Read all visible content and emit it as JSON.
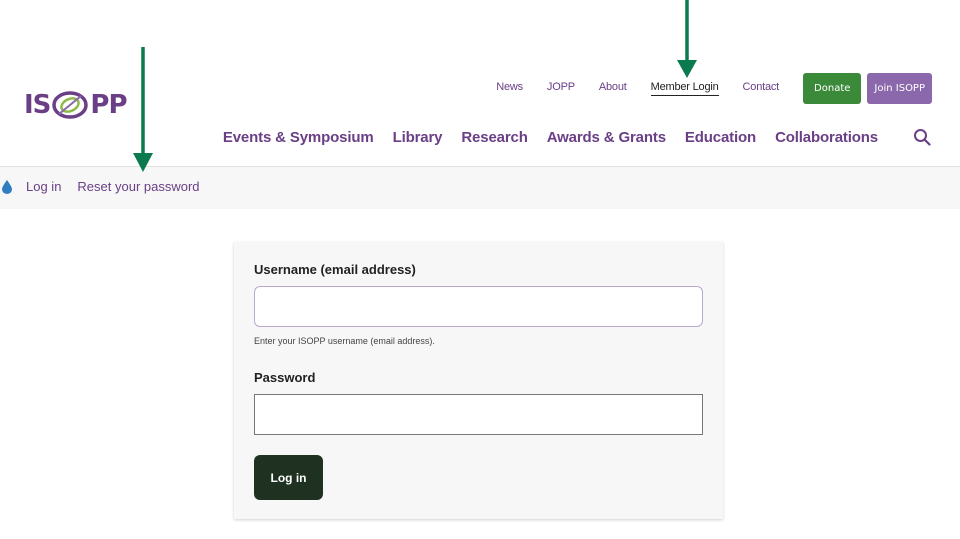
{
  "header": {
    "logo": {
      "text_before": "IS",
      "text_after": "PP",
      "brand_color": "#6a3f86",
      "accent_color": "#8dbb4a"
    },
    "top_links": [
      {
        "label": "News"
      },
      {
        "label": "JOPP"
      },
      {
        "label": "About"
      },
      {
        "label": "Member Login",
        "active": true
      },
      {
        "label": "Contact"
      }
    ],
    "donate_label": "Donate",
    "join_label": "Join ISOPP",
    "main_nav": [
      {
        "label": "Events & Symposium"
      },
      {
        "label": "Library"
      },
      {
        "label": "Research"
      },
      {
        "label": "Awards & Grants"
      },
      {
        "label": "Education"
      },
      {
        "label": "Collaborations"
      }
    ],
    "search_icon": "search-icon"
  },
  "breadcrumb": {
    "icon": "drop-icon",
    "items": [
      {
        "label": "Log in"
      },
      {
        "label": "Reset your password"
      }
    ]
  },
  "login_form": {
    "username_label": "Username (email address)",
    "username_value": "",
    "username_help": "Enter your ISOPP username (email address).",
    "password_label": "Password",
    "password_value": "",
    "submit_label": "Log in"
  },
  "colors": {
    "link": "#6a3f86",
    "donate_bg": "#3a8a3a",
    "join_bg": "#8b68ac",
    "login_button_bg": "#1f3120",
    "annotation_arrow": "#0b7a4f"
  }
}
